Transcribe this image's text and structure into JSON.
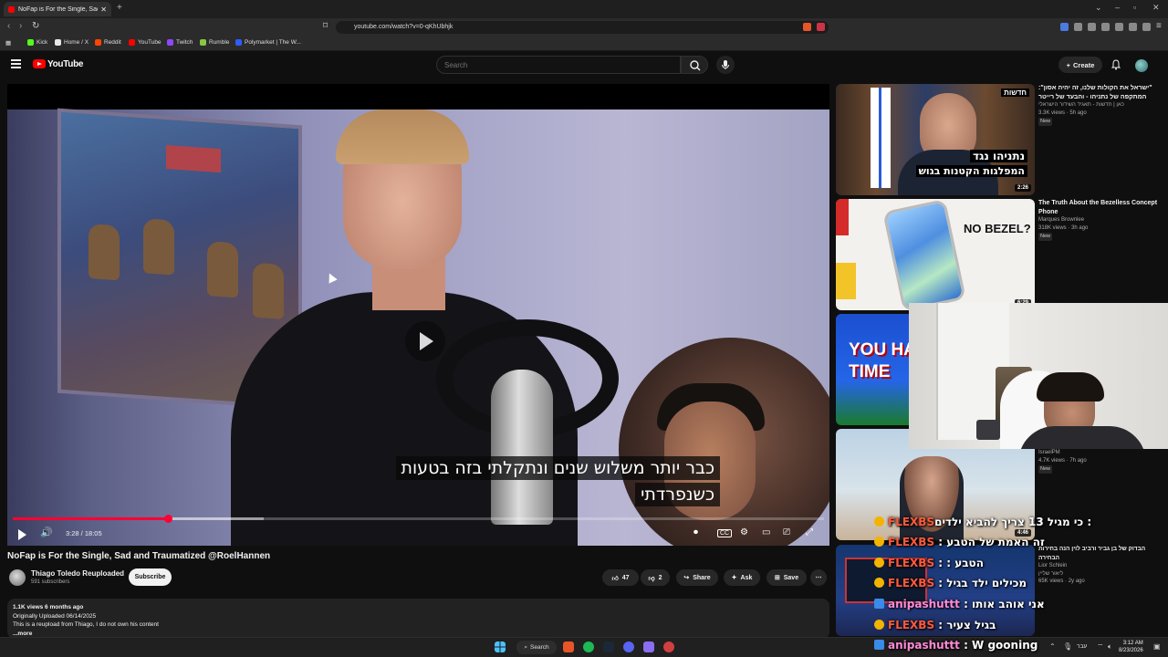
{
  "browser": {
    "tab_title": "NoFap is For the Single, Sad and Traumatized @RoelHannen",
    "url": "youtube.com/watch?v=0-qKhUbhjk",
    "bookmarks": [
      {
        "label": "Kick",
        "color": "#53fc18"
      },
      {
        "label": "Home / X",
        "color": "#e7e7e7"
      },
      {
        "label": "Reddit",
        "color": "#ff4500"
      },
      {
        "label": "YouTube",
        "color": "#ff0000"
      },
      {
        "label": "Twitch",
        "color": "#9146ff"
      },
      {
        "label": "Rumble",
        "color": "#85c742"
      },
      {
        "label": "Polymarket | The W...",
        "color": "#2e5cff"
      }
    ]
  },
  "header": {
    "brand": "YouTube",
    "search_placeholder": "Search",
    "create_label": "Create"
  },
  "player": {
    "subtitle_line1": "כבר יותר משלוש שנים ונתקלתי בזה בטעות",
    "subtitle_line2": "כשנפרדתי",
    "time_display": "3:28 / 18:05",
    "progress_played": 0.1917,
    "progress_buffered": 0.309
  },
  "video": {
    "title": "NoFap is For the Single, Sad and Traumatized @RoelHannen",
    "channel_name": "Thiago Toledo Reuploaded",
    "subscribers": "591 subscribers",
    "subscribe_label": "Subscribe",
    "likes": "47",
    "dislikes": "2",
    "share_label": "Share",
    "ask_label": "Ask",
    "save_label": "Save",
    "description": {
      "stats": "1.1K views  6 months ago",
      "line1": "Originally Uploaded 06/14/2025",
      "line2": "This is a reupload from Thiago, I do not own his content",
      "more": "...more"
    }
  },
  "recommendations": [
    {
      "title": "\"ישראל את הקולות שלנו, זה יהיה אסון\": המתקפה של נתניהו - והבעד של רייטר",
      "channel": "כאן | חדשות - תאגיד השידור הישראלי",
      "views": "3.3K views",
      "age": "5h ago",
      "badge": "New",
      "duration": "2:26",
      "thumb_text_top": "נתניהו נגד",
      "thumb_text_bottom": "המפלגות הקטנות בגוש",
      "thumb_tag": "חדשות"
    },
    {
      "title": "The Truth About the Bezelless Concept Phone",
      "channel": "Marques Brownlee",
      "views": "318K views",
      "age": "3h ago",
      "badge": "New",
      "duration": "6:29",
      "thumb_text": "NO BEZEL?"
    },
    {
      "thumb_text": "YOU HA TIME"
    },
    {
      "channel": "IsraelPM",
      "views": "4.7K views",
      "age": "7h ago",
      "badge": "New",
      "duration": "4:46"
    },
    {
      "title": "הבדוק של בן גביר ורביב לוין הנה בחירות הבחירה",
      "channel": "Lior Schlein",
      "channel_he": "ליאור שליין",
      "views": "65K views",
      "age": "2y ago"
    }
  ],
  "chat": [
    {
      "user": "FLEXBS",
      "msg": "כי מגיל 13 צריך להביא ילדים",
      "user_color": "#ff5a3c"
    },
    {
      "user": "FLEXBS",
      "msg": "זה האמת של הטבע",
      "user_color": "#ff5a3c"
    },
    {
      "user": "FLEXBS",
      "msg": "הטבע :",
      "user_color": "#ff5a3c"
    },
    {
      "user": "FLEXBS",
      "msg": "מכילים ילד בגיל",
      "user_color": "#ff5a3c"
    },
    {
      "user": "anipashuttt",
      "msg": "אני אוהב אותו",
      "user_color": "#ff8ad8"
    },
    {
      "user": "FLEXBS",
      "msg": "בגיל צעיר",
      "user_color": "#ff5a3c"
    },
    {
      "user": "anipashuttt",
      "msg": "W gooning",
      "user_color": "#ff8ad8"
    }
  ],
  "taskbar": {
    "search_label": "Search",
    "lang": "עבר",
    "time": "3:12 AM",
    "date": "8/23/2026"
  }
}
